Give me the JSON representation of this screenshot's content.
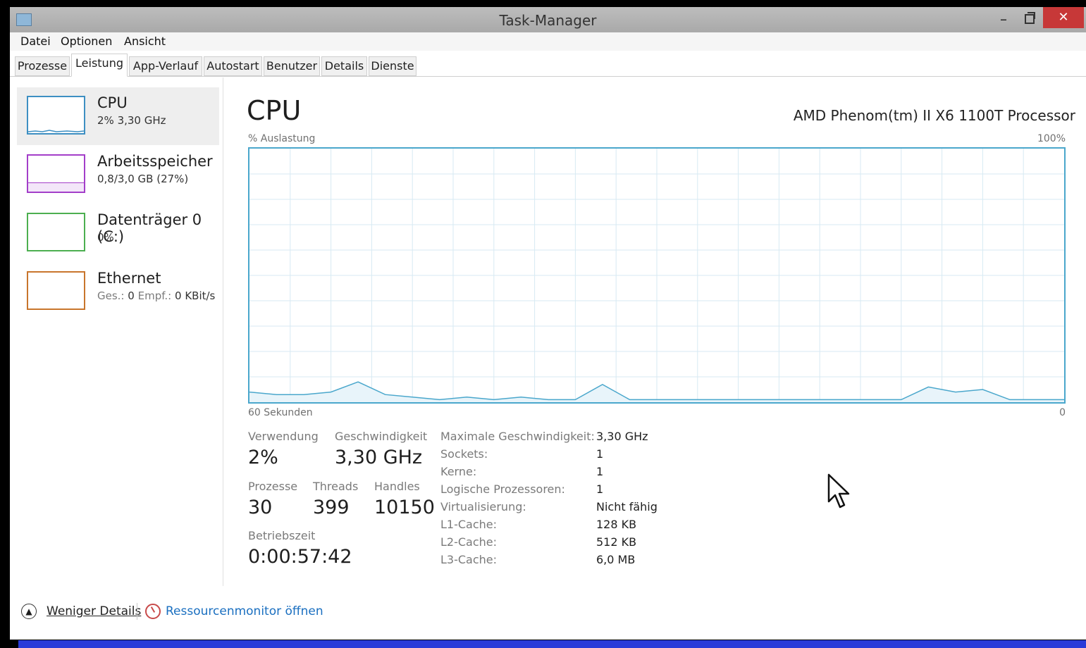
{
  "window": {
    "title": "Task-Manager",
    "min_glyph": "–",
    "close_glyph": "✕"
  },
  "menu": [
    "Datei",
    "Optionen",
    "Ansicht"
  ],
  "tabs": [
    "Prozesse",
    "Leistung",
    "App-Verlauf",
    "Autostart",
    "Benutzer",
    "Details",
    "Dienste"
  ],
  "sidebar": {
    "cpu": {
      "name": "CPU",
      "sub": "2% 3,30 GHz",
      "color": "#3d8fc2"
    },
    "memory": {
      "name": "Arbeitsspeicher",
      "sub": "0,8/3,0 GB (27%)",
      "color": "#a33ec9"
    },
    "disk": {
      "name": "Datenträger 0 (C:)",
      "sub": "0%",
      "color": "#4caf50"
    },
    "ethernet": {
      "name": "Ethernet",
      "sub_label1": "Ges.:",
      "sub_val1": "0",
      "sub_label2": "Empf.:",
      "sub_val2": "0 KBit/s",
      "color": "#c8752c"
    }
  },
  "main": {
    "title": "CPU",
    "processor": "AMD Phenom(tm) II X6 1100T Processor",
    "y_label": "% Auslastung",
    "y_max_label": "100%",
    "x_label": "60 Sekunden",
    "x_min_label": "0"
  },
  "chart_data": {
    "type": "area",
    "x": [
      60,
      58,
      56,
      54,
      52,
      50,
      48,
      46,
      44,
      42,
      40,
      38,
      36,
      34,
      32,
      30,
      28,
      26,
      24,
      22,
      20,
      18,
      16,
      14,
      12,
      10,
      8,
      6,
      4,
      2,
      0
    ],
    "values": [
      4,
      3,
      3,
      4,
      8,
      3,
      2,
      1,
      2,
      1,
      2,
      1,
      1,
      7,
      1,
      1,
      1,
      1,
      1,
      1,
      1,
      1,
      1,
      1,
      1,
      6,
      4,
      5,
      1,
      1,
      1
    ],
    "ylim": [
      0,
      100
    ],
    "grid": true,
    "color": "#4aa7cc"
  },
  "stats": {
    "usage_label": "Verwendung",
    "usage": "2%",
    "speed_label": "Geschwindigkeit",
    "speed": "3,30 GHz",
    "proc_label": "Prozesse",
    "proc": "30",
    "threads_label": "Threads",
    "threads": "399",
    "handles_label": "Handles",
    "handles": "10150",
    "uptime_label": "Betriebszeit",
    "uptime": "0:00:57:42"
  },
  "specs": [
    {
      "label": "Maximale Geschwindigkeit:",
      "value": "3,30 GHz"
    },
    {
      "label": "Sockets:",
      "value": "1"
    },
    {
      "label": "Kerne:",
      "value": "1"
    },
    {
      "label": "Logische Prozessoren:",
      "value": "1"
    },
    {
      "label": "Virtualisierung:",
      "value": "Nicht fähig"
    },
    {
      "label": "L1-Cache:",
      "value": "128 KB"
    },
    {
      "label": "L2-Cache:",
      "value": "512 KB"
    },
    {
      "label": "L3-Cache:",
      "value": "6,0 MB"
    }
  ],
  "footer": {
    "less_details": "Weniger Details",
    "resource_monitor": "Ressourcenmonitor öffnen"
  }
}
